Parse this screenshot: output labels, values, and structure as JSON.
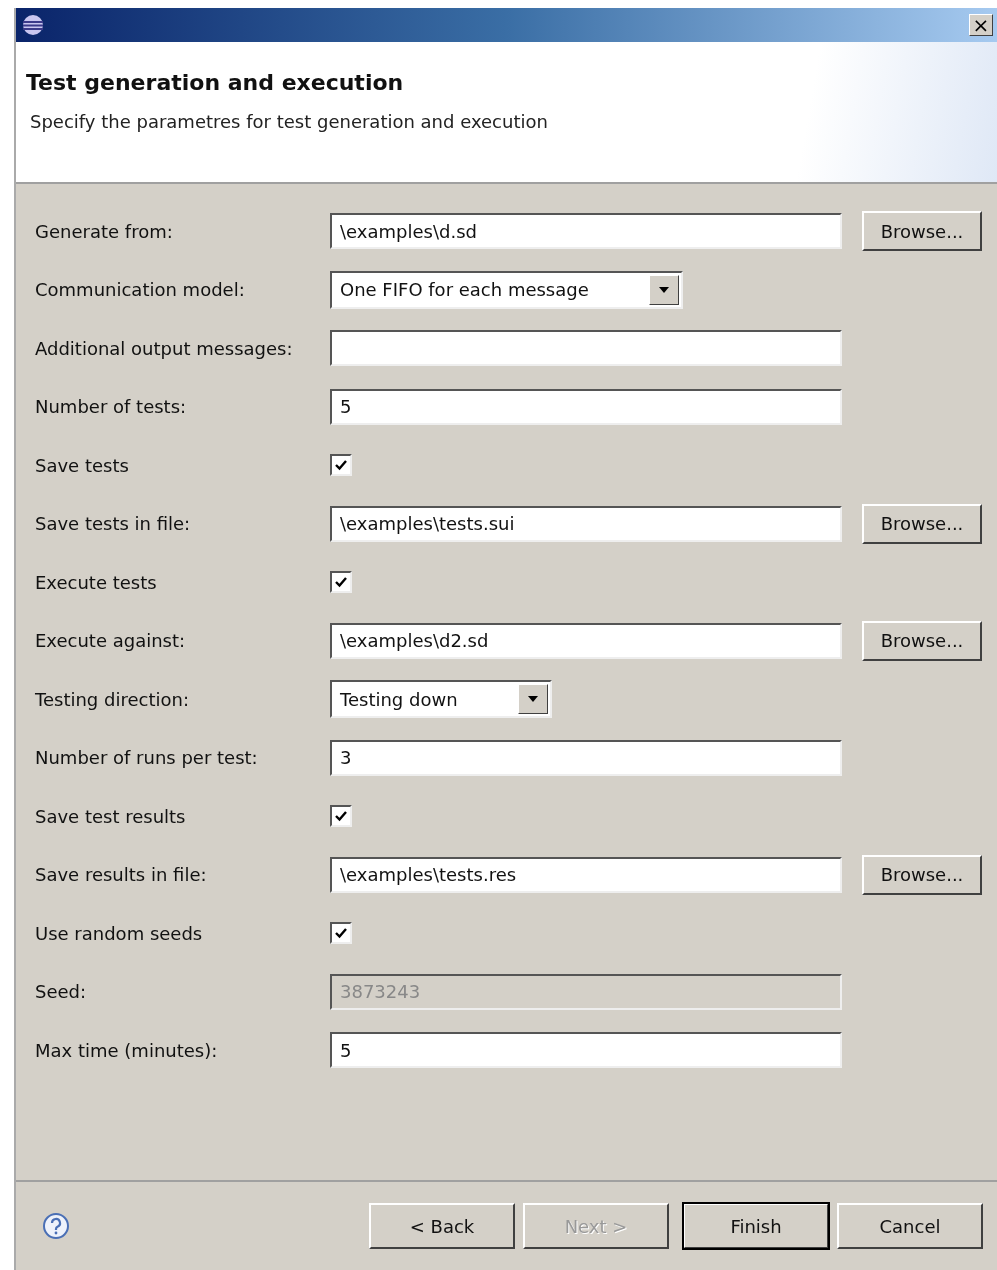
{
  "window": {
    "close": "×"
  },
  "header": {
    "title": "Test generation and execution",
    "description": "Specify the parametres for test generation and execution"
  },
  "fields": [
    {
      "kind": "text",
      "label": "Generate from:",
      "value": "\\examples\\d.sd",
      "disabled": false,
      "browse": "Browse..."
    },
    {
      "kind": "select",
      "label": "Communication model:",
      "value": "One FIFO for each message"
    },
    {
      "kind": "text",
      "label": "Additional output messages:",
      "disabled": false
    },
    {
      "kind": "text",
      "label": "Number of tests:",
      "value": "5",
      "disabled": false
    },
    {
      "kind": "checkbox",
      "label": "Save tests",
      "checked": true
    },
    {
      "kind": "text",
      "label": "Save tests in file:",
      "value": "\\examples\\tests.sui",
      "disabled": false,
      "browse": "Browse..."
    },
    {
      "kind": "checkbox",
      "label": "Execute tests",
      "checked": true
    },
    {
      "kind": "text",
      "label": "Execute against:",
      "value": "\\examples\\d2.sd",
      "disabled": false,
      "browse": "Browse..."
    },
    {
      "kind": "select",
      "label": "Testing direction:",
      "value": "Testing down"
    },
    {
      "kind": "text",
      "label": "Number of runs per test:",
      "value": "3",
      "disabled": false
    },
    {
      "kind": "checkbox",
      "label": "Save test results",
      "checked": true
    },
    {
      "kind": "text",
      "label": "Save results in file:",
      "value": "\\examples\\tests.res",
      "disabled": false,
      "browse": "Browse..."
    },
    {
      "kind": "checkbox",
      "label": "Use random seeds",
      "checked": true
    },
    {
      "kind": "text",
      "label": "Seed:",
      "value": "3873243",
      "disabled": true
    },
    {
      "kind": "text",
      "label": "Max time (minutes):",
      "value": "5",
      "disabled": false
    }
  ],
  "buttons": [
    {
      "label": "< Back",
      "disabled": false,
      "default": false
    },
    {
      "label": "Next >",
      "disabled": true,
      "default": false
    },
    {
      "label": "Finish",
      "disabled": false,
      "default": true
    },
    {
      "label": "Cancel",
      "disabled": false,
      "default": false
    }
  ]
}
